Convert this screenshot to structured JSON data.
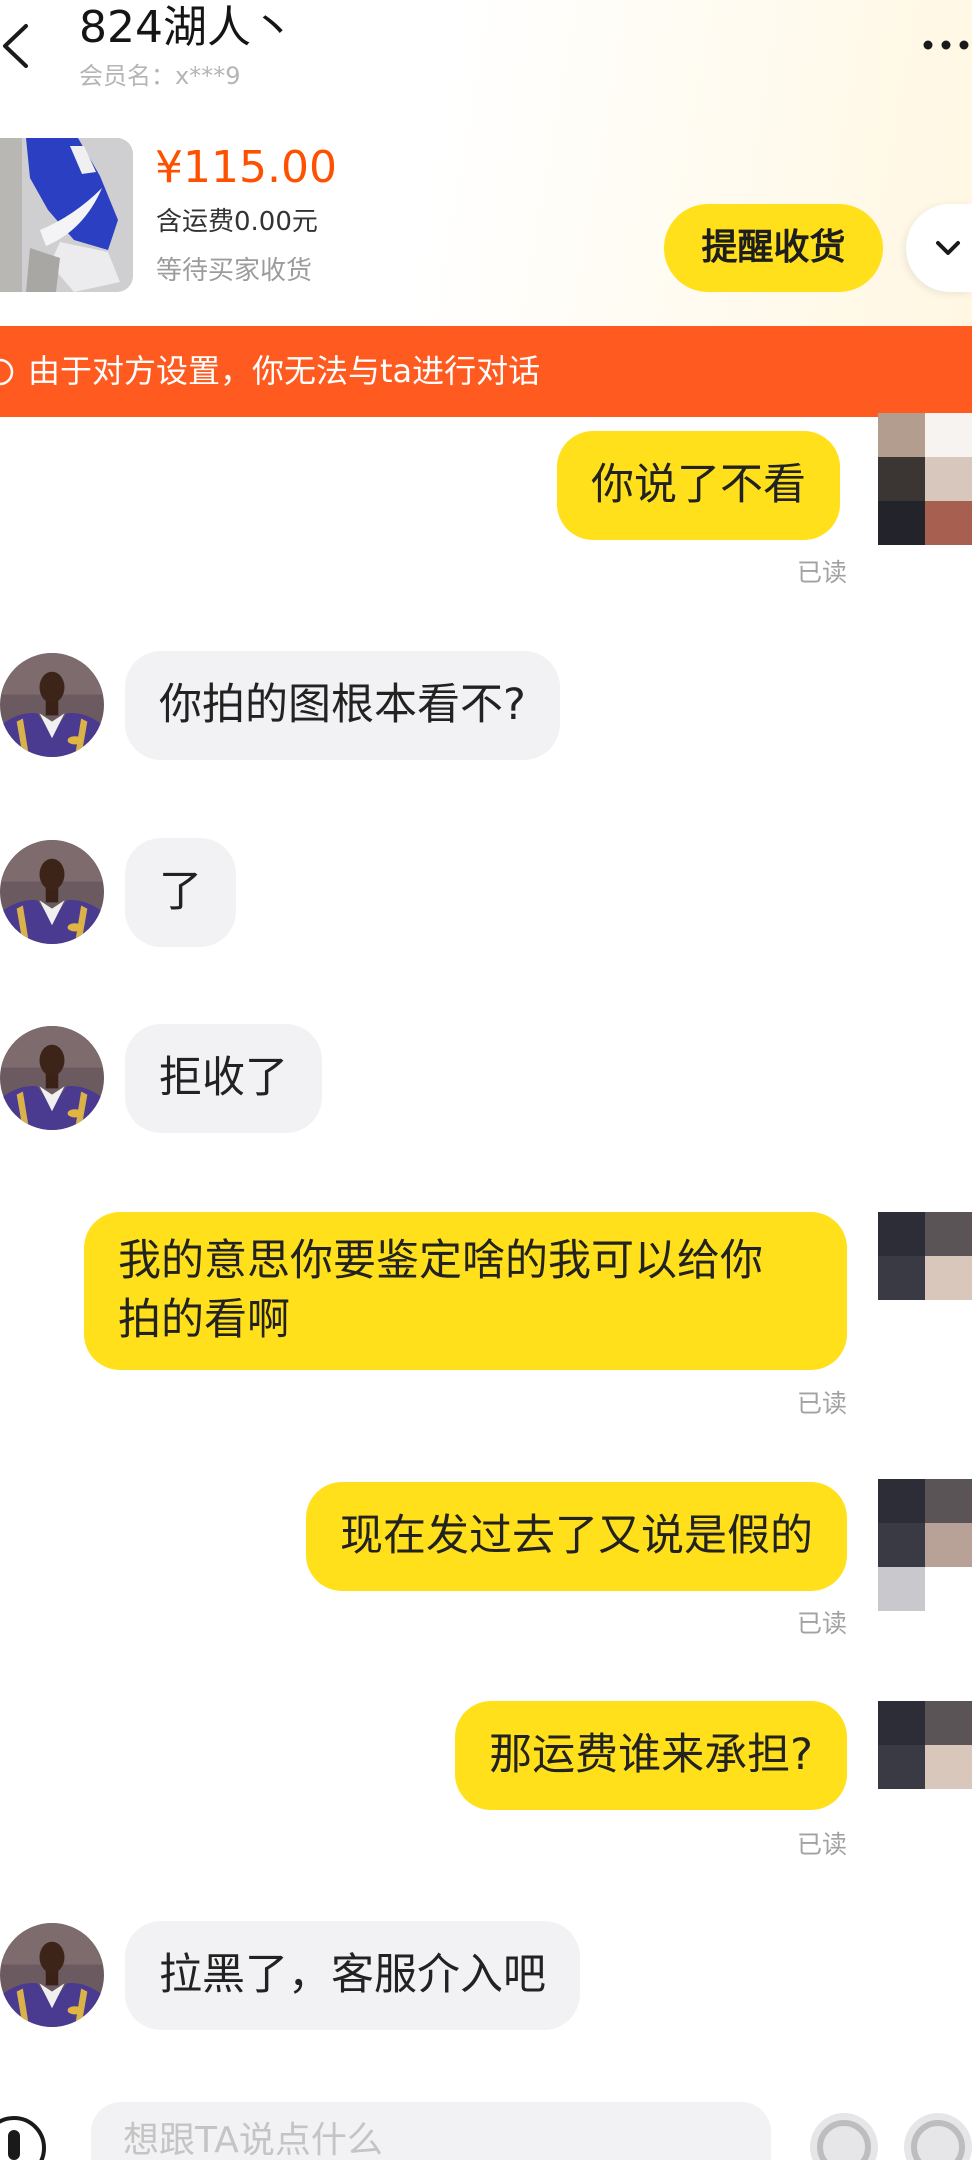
{
  "header": {
    "title": "824湖人丶",
    "member": "会员名：x***9"
  },
  "order": {
    "price": "¥115.00",
    "shipping": "含运费0.00元",
    "status": "等待买家收货",
    "remind_button": "提醒收货"
  },
  "banner": {
    "text": "由于对方设置，你无法与ta进行对话"
  },
  "messages": [
    {
      "outgoing": true,
      "lines": [
        "你说了不看"
      ],
      "read": "已读"
    },
    {
      "outgoing": false,
      "lines": [
        "你拍的图根本看不?"
      ]
    },
    {
      "outgoing": false,
      "lines": [
        "了"
      ]
    },
    {
      "outgoing": false,
      "lines": [
        "拒收了"
      ]
    },
    {
      "outgoing": true,
      "lines": [
        "我的意思你要鉴定啥的我可以给你",
        "拍的看啊"
      ],
      "read": "已读"
    },
    {
      "outgoing": true,
      "lines": [
        "现在发过去了又说是假的"
      ],
      "read": "已读"
    },
    {
      "outgoing": true,
      "lines": [
        "那运费谁来承担?"
      ],
      "read": "已读"
    },
    {
      "outgoing": false,
      "lines": [
        "拉黑了，客服介入吧"
      ]
    }
  ],
  "input": {
    "placeholder": "想跟TA说点什么"
  },
  "icons": {
    "back": "chevron-left-icon",
    "more": "more-icon",
    "expand": "chevron-down-icon",
    "info": "info-icon",
    "mic": "microphone-icon",
    "emoji": "emoji-icon",
    "plus": "plus-icon"
  },
  "colors": {
    "bubble_mine": "#ffe01b",
    "bubble_theirs": "#f2f2f4",
    "price": "#ff5000",
    "banner": "#ff5a1f"
  }
}
